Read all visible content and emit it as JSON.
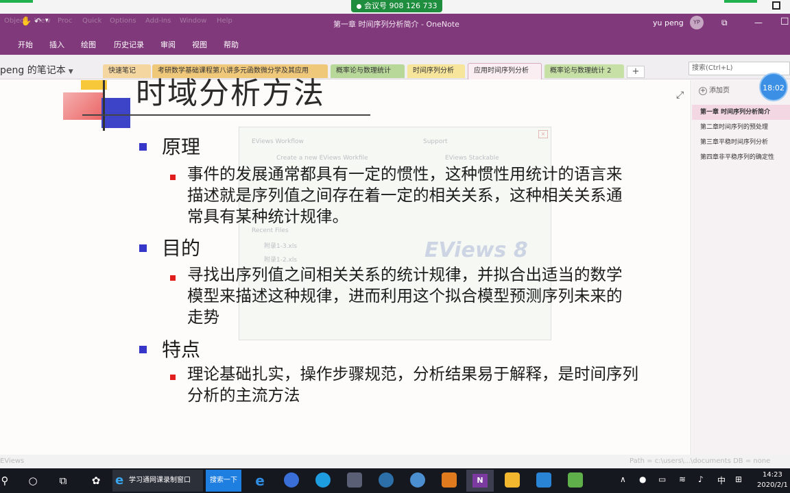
{
  "meeting": {
    "label": "会议号 908 126 733"
  },
  "window": {
    "title": "第一章 时间序列分析简介 - OneNote",
    "user": "yu peng",
    "avatar": "YP"
  },
  "menubar_ghost": [
    "Object",
    "View",
    "Proc",
    "Quick",
    "Options",
    "Add-ins",
    "Window",
    "Help"
  ],
  "ribbon": [
    "开始",
    "插入",
    "绘图",
    "历史记录",
    "审阅",
    "视图",
    "帮助"
  ],
  "notebook": {
    "name": "peng 的笔记本"
  },
  "tabs": [
    {
      "label": "快速笔记",
      "color": "#f3d6a0"
    },
    {
      "label": "考研数学基础课程第八讲多元函数微分学及其应用",
      "color": "#f0c87a"
    },
    {
      "label": "概率论与数理统计",
      "color": "#b8d89a"
    },
    {
      "label": "时间序列分析",
      "color": "#f6e59b"
    },
    {
      "label": "应用时间序列分析",
      "color": "#fbeef3"
    },
    {
      "label": "概率论与数理统计 2",
      "color": "#c6e0a6"
    }
  ],
  "search": {
    "placeholder": "搜索(Ctrl+L)"
  },
  "slide": {
    "title": "时域分析方法",
    "sections": [
      {
        "heading": "原理",
        "text": "事件的发展通常都具有一定的惯性，这种惯性用统计的语言来描述就是序列值之间存在着一定的相关关系，这种相关关系通常具有某种统计规律。"
      },
      {
        "heading": "目的",
        "text": "寻找出序列值之间相关关系的统计规律，并拟合出适当的数学模型来描述这种规律，进而利用这个拟合模型预测序列未来的走势"
      },
      {
        "heading": "特点",
        "text": "理论基础扎实，操作步骤规范，分析结果易于解释，是时间序列分析的主流方法"
      }
    ]
  },
  "ghost_dialog": {
    "workflow": "EViews Workflow",
    "create": "Create a new EViews Workfile",
    "support": "Support",
    "stack": "EViews Stackable",
    "recent": "Recent Files",
    "file1": "附录1-3.xls",
    "file2": "附录1-2.xls",
    "logo": "EViews 8"
  },
  "right_panel": {
    "add_page": "添加页",
    "pages": [
      {
        "label": "第一章 时间序列分析简介",
        "active": true
      },
      {
        "label": "第二章时间序列的预处理",
        "active": false
      },
      {
        "label": "第三章平稳时间序列分析",
        "active": false
      },
      {
        "label": "第四章非平稳序列的确定性",
        "active": false
      }
    ]
  },
  "clock_badge": "18:02",
  "status": {
    "left": "EViews",
    "right": "Path = c:\\users\\...\\documents    DB = none"
  },
  "taskbar": {
    "ie_label": "学习通网课录制窗口",
    "search_label": "搜索一下",
    "tray_lang": "中",
    "time": "14:23",
    "date": "2020/2/1"
  }
}
